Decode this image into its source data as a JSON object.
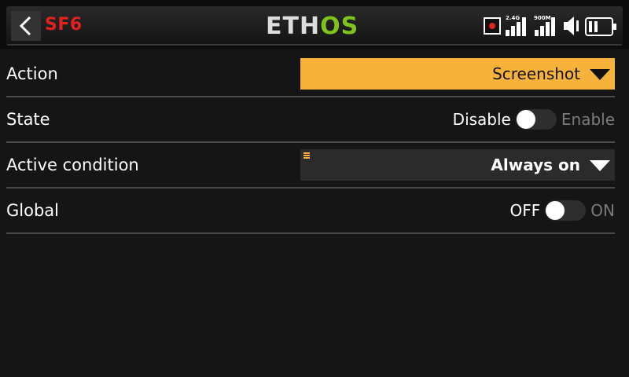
{
  "header": {
    "title": "SF6",
    "logo_left": "ETH",
    "logo_right": "OS",
    "status": {
      "signal1_label": "2.4G",
      "signal2_label": "900M",
      "icons": [
        "record-icon",
        "signal-2.4g-icon",
        "signal-900m-icon",
        "volume-muted-icon",
        "battery-icon"
      ]
    }
  },
  "rows": {
    "action": {
      "label": "Action",
      "value": "Screenshot"
    },
    "state": {
      "label": "State",
      "off_label": "Disable",
      "on_label": "Enable",
      "enabled": false
    },
    "active_condition": {
      "label": "Active condition",
      "value": "Always on"
    },
    "global": {
      "label": "Global",
      "off_label": "OFF",
      "on_label": "ON",
      "enabled": false
    }
  },
  "colors": {
    "accent": "#f7b23b",
    "title_red": "#e3221d",
    "logo_green": "#7fc31c",
    "background": "#151515"
  }
}
